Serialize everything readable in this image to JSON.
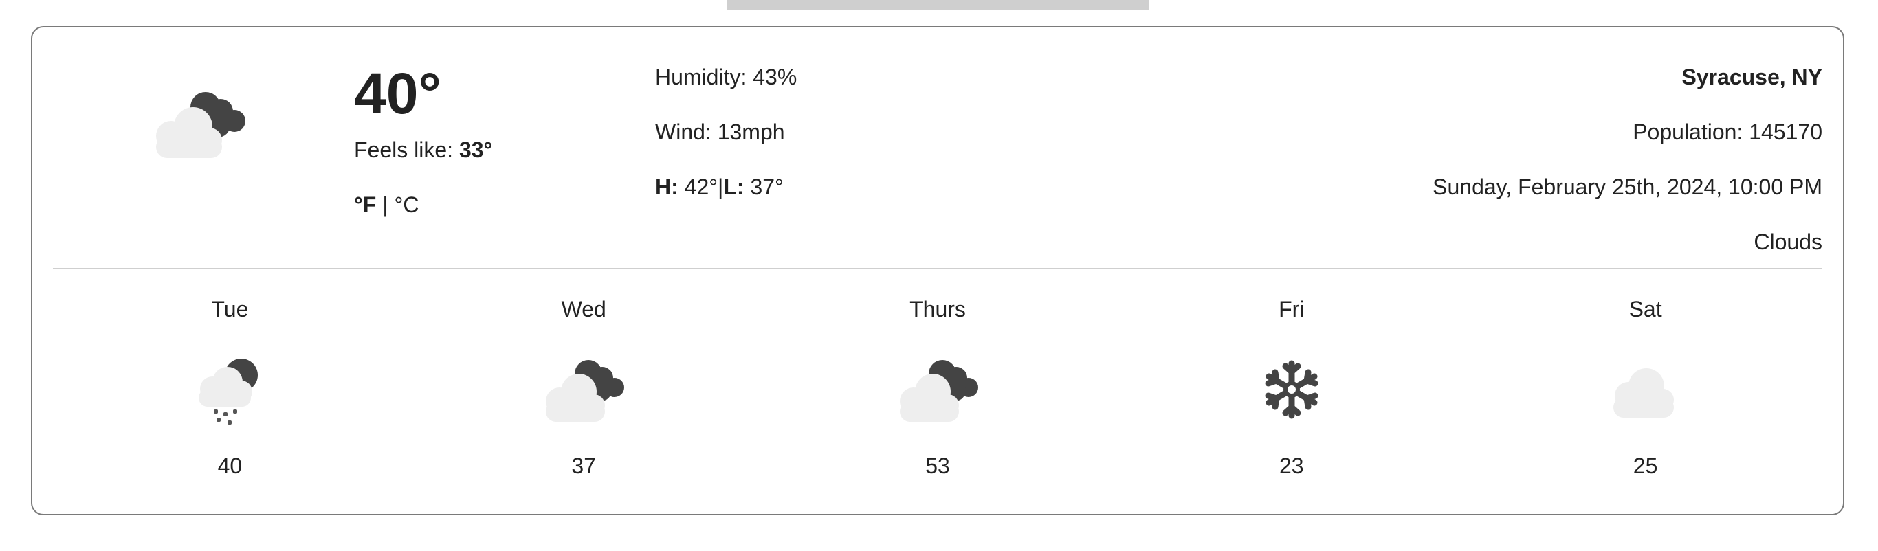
{
  "current": {
    "temperature": "40°",
    "feels_like_label": "Feels like:",
    "feels_like_value": "33°",
    "unit_f": "°F",
    "unit_separator": "|",
    "unit_c": "°C",
    "icon": "clouds-night-icon"
  },
  "details": {
    "humidity": "Humidity: 43%",
    "wind": "Wind: 13mph",
    "high_label": "H:",
    "high_value": "42°",
    "low_label": "L:",
    "low_value": "37°"
  },
  "location": {
    "city": "Syracuse, NY",
    "population": "Population: 145170",
    "datetime": "Sunday, February 25th, 2024, 10:00 PM",
    "condition": "Clouds"
  },
  "forecast": [
    {
      "day": "Tue",
      "temp": "40",
      "icon": "rain-night-icon"
    },
    {
      "day": "Wed",
      "temp": "37",
      "icon": "clouds-night-icon"
    },
    {
      "day": "Thurs",
      "temp": "53",
      "icon": "clouds-night-icon"
    },
    {
      "day": "Fri",
      "temp": "23",
      "icon": "snowflake-icon"
    },
    {
      "day": "Sat",
      "temp": "25",
      "icon": "cloud-icon"
    }
  ]
}
